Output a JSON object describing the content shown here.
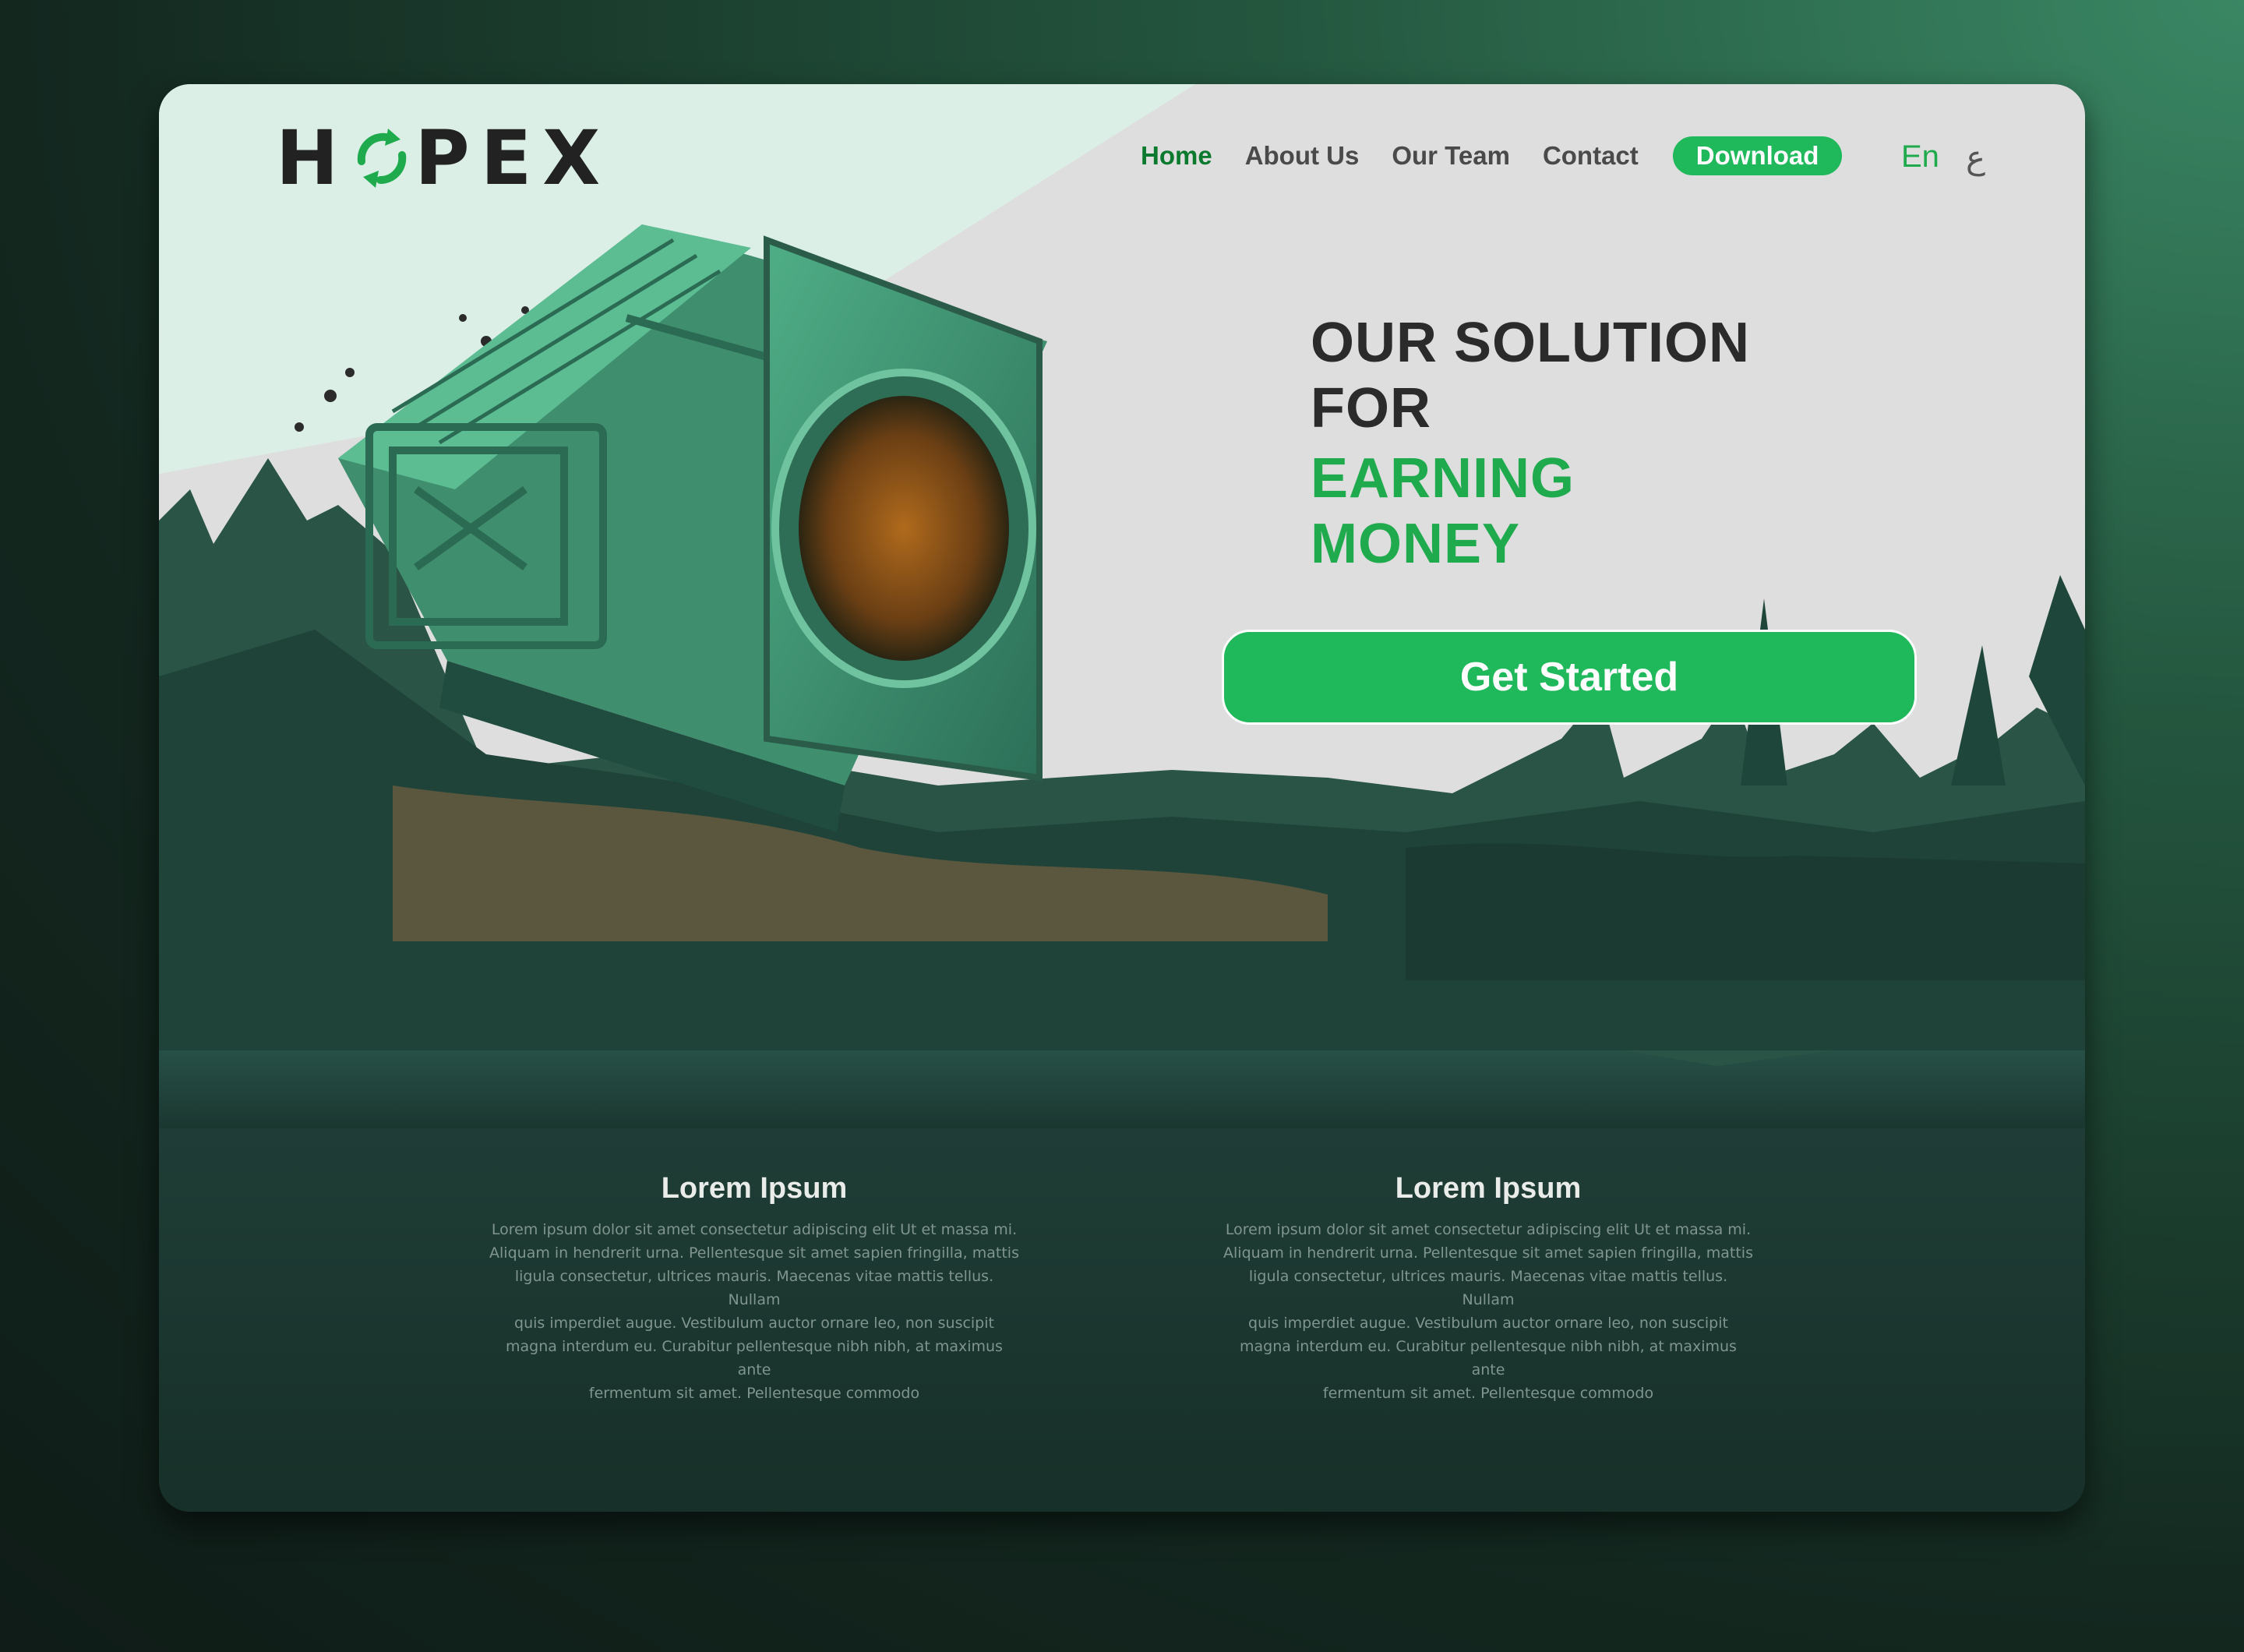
{
  "brand": {
    "logo_text_1": "H",
    "logo_text_2": "PEX",
    "logo_icon": "recycle-icon",
    "accent": "#1fb85a",
    "dark_accent": "#0c7a2e"
  },
  "nav": {
    "items": [
      {
        "label": "Home",
        "active": true
      },
      {
        "label": "About Us",
        "active": false
      },
      {
        "label": "Our Team",
        "active": false
      },
      {
        "label": "Contact",
        "active": false
      }
    ],
    "download_label": "Download"
  },
  "lang": {
    "en": "En",
    "ar": "ع"
  },
  "hero": {
    "line1": "OUR SOLUTION",
    "line2": "FOR",
    "line3": "EARNING",
    "line4": "MONEY",
    "cta_label": "Get Started",
    "image": "recycling-machine-illustration"
  },
  "features": [
    {
      "title": "Lorem Ipsum",
      "body": [
        "Lorem ipsum dolor sit amet consectetur adipiscing elit Ut et massa mi.",
        "Aliquam in hendrerit urna. Pellentesque sit amet sapien fringilla, mattis",
        "ligula consectetur, ultrices mauris. Maecenas vitae mattis tellus. Nullam",
        "quis imperdiet augue. Vestibulum auctor ornare leo, non suscipit",
        "magna interdum eu. Curabitur pellentesque nibh nibh, at maximus ante",
        "fermentum sit amet. Pellentesque commodo"
      ]
    },
    {
      "title": "Lorem Ipsum",
      "body": [
        "Lorem ipsum dolor sit amet consectetur adipiscing elit Ut et massa mi.",
        "Aliquam in hendrerit urna. Pellentesque sit amet sapien fringilla, mattis",
        "ligula consectetur, ultrices mauris. Maecenas vitae mattis tellus. Nullam",
        "quis imperdiet augue. Vestibulum auctor ornare leo, non suscipit",
        "magna interdum eu. Curabitur pellentesque nibh nibh, at maximus ante",
        "fermentum sit amet. Pellentesque commodo"
      ]
    }
  ]
}
